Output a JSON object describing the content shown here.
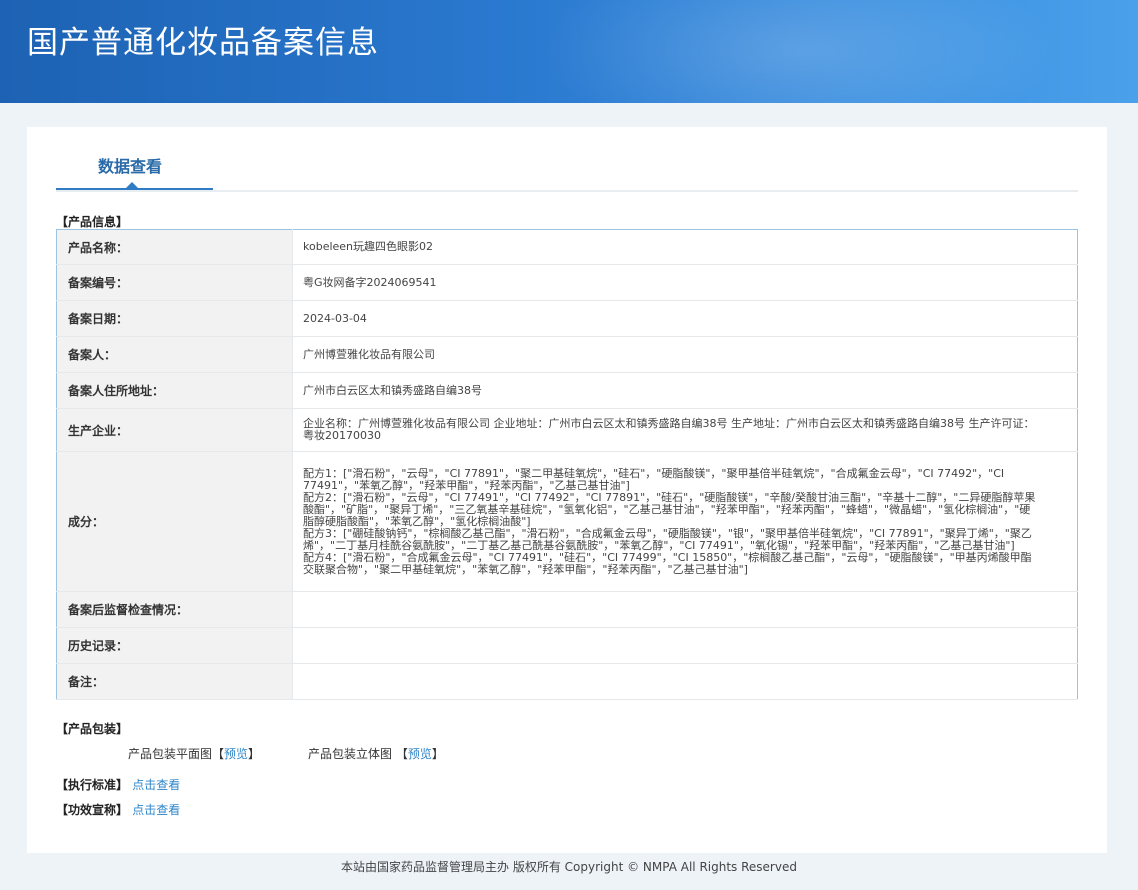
{
  "header": {
    "title": "国产普通化妆品备案信息"
  },
  "tabs": {
    "active_label": "数据查看"
  },
  "product_info": {
    "section_title": "【产品信息】",
    "rows": [
      {
        "label": "产品名称：",
        "value": "kobeleen玩趣四色眼影02"
      },
      {
        "label": "备案编号：",
        "value": "粤G妆网备字2024069541"
      },
      {
        "label": "备案日期：",
        "value": "2024-03-04"
      },
      {
        "label": "备案人：",
        "value": "广州博萱雅化妆品有限公司"
      },
      {
        "label": "备案人住所地址：",
        "value": "广州市白云区太和镇秀盛路自编38号"
      },
      {
        "label": "生产企业：",
        "value": "企业名称：广州博萱雅化妆品有限公司 企业地址：广州市白云区太和镇秀盛路自编38号 生产地址：广州市白云区太和镇秀盛路自编38号 生产许可证：粤妆20170030"
      },
      {
        "label": "成分：",
        "value": "配方1：[\"滑石粉\"，\"云母\"，\"CI 77891\"，\"聚二甲基硅氧烷\"，\"硅石\"，\"硬脂酸镁\"，\"聚甲基倍半硅氧烷\"，\"合成氟金云母\"，\"CI 77492\"，\"CI 77491\"，\"苯氧乙醇\"，\"羟苯甲酯\"，\"羟苯丙酯\"，\"乙基己基甘油\"]\n配方2：[\"滑石粉\"，\"云母\"，\"CI 77491\"，\"CI 77492\"，\"CI 77891\"，\"硅石\"，\"硬脂酸镁\"，\"辛酸/癸酸甘油三酯\"，\"辛基十二醇\"，\"二异硬脂醇苹果酸酯\"，\"矿脂\"，\"聚异丁烯\"，\"三乙氧基辛基硅烷\"，\"氢氧化铝\"，\"乙基己基甘油\"，\"羟苯甲酯\"，\"羟苯丙酯\"，\"蜂蜡\"，\"微晶蜡\"，\"氢化棕榈油\"，\"硬脂醇硬脂酸酯\"，\"苯氧乙醇\"，\"氢化棕榈油酸\"]\n配方3：[\"硼硅酸钠钙\"，\"棕榈酸乙基己酯\"，\"滑石粉\"，\"合成氟金云母\"，\"硬脂酸镁\"，\"银\"，\"聚甲基倍半硅氧烷\"，\"CI 77891\"，\"聚异丁烯\"，\"聚乙烯\"，\"二丁基月桂酰谷氨酰胺\"，\"二丁基乙基己酰基谷氨酰胺\"，\"苯氧乙醇\"，\"CI 77491\"，\"氧化锡\"，\"羟苯甲酯\"，\"羟苯丙酯\"，\"乙基己基甘油\"]\n配方4：[\"滑石粉\"，\"合成氟金云母\"，\"CI 77491\"，\"硅石\"，\"CI 77499\"，\"CI 15850\"，\"棕榈酸乙基己酯\"，\"云母\"，\"硬脂酸镁\"，\"甲基丙烯酸甲酯交联聚合物\"，\"聚二甲基硅氧烷\"，\"苯氧乙醇\"，\"羟苯甲酯\"，\"羟苯丙酯\"，\"乙基己基甘油\"]"
      },
      {
        "label": "备案后监督检查情况：",
        "value": ""
      },
      {
        "label": "历史记录：",
        "value": ""
      },
      {
        "label": "备注：",
        "value": ""
      }
    ]
  },
  "packaging": {
    "section_title": "【产品包装】",
    "flat_label": "产品包装平面图",
    "stereo_label": "产品包装立体图",
    "preview_label": "预览",
    "bracket_open": "【",
    "bracket_close": "】"
  },
  "standard": {
    "label": "【执行标准】",
    "link": "点击查看"
  },
  "efficacy": {
    "label": "【功效宣称】",
    "link": "点击查看"
  },
  "footer": {
    "text": "本站由国家药品监督管理局主办 版权所有 Copyright © NMPA All Rights Reserved"
  }
}
